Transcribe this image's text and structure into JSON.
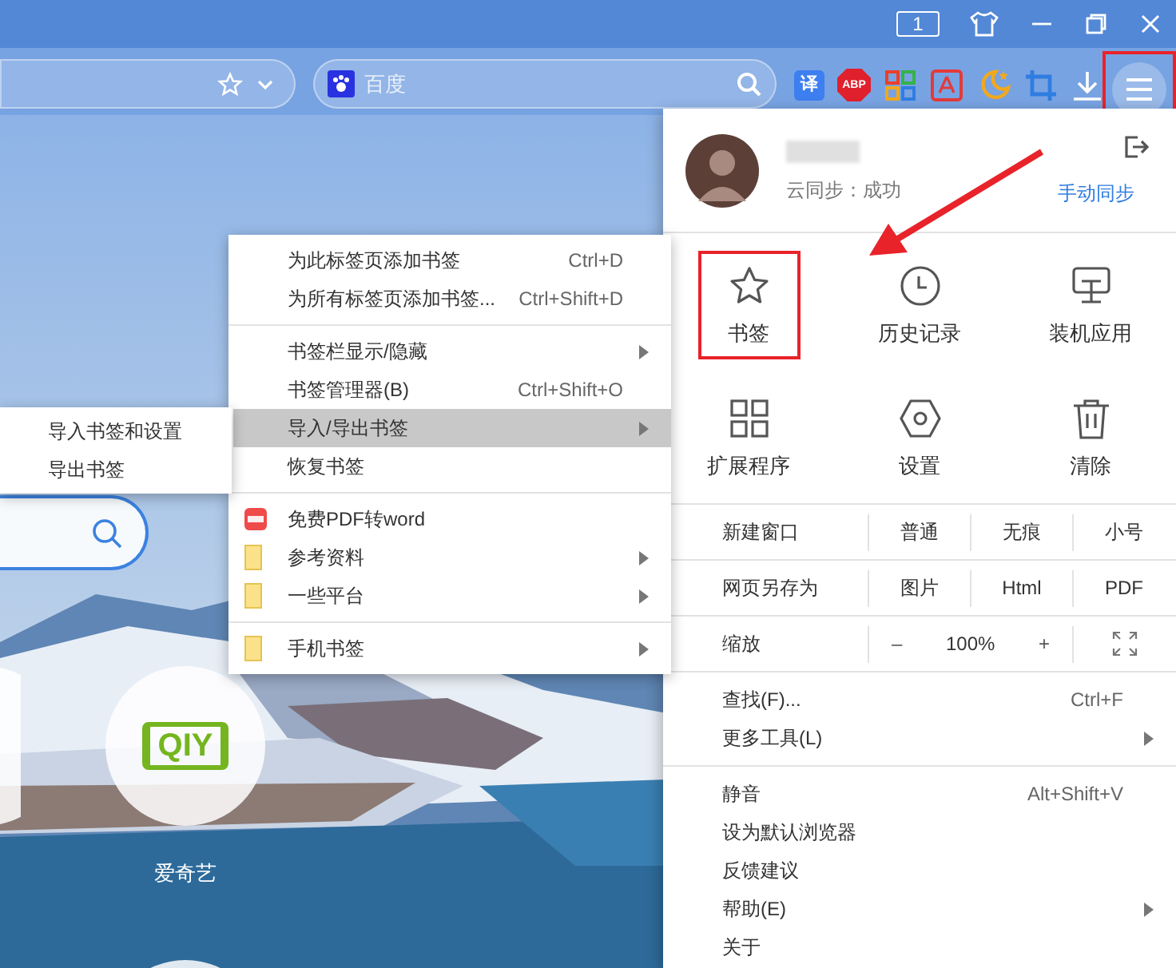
{
  "window_controls": {
    "tab_count": "1"
  },
  "toolbar": {
    "search_field": {
      "placeholder": "百度"
    },
    "extensions": [
      {
        "kind": "translate",
        "label": "译"
      },
      {
        "kind": "abp",
        "label": "ABP"
      },
      {
        "kind": "apps"
      },
      {
        "kind": "pdf"
      },
      {
        "kind": "night"
      },
      {
        "kind": "crop"
      },
      {
        "kind": "download"
      }
    ],
    "menu_button": {
      "highlighted": true
    }
  },
  "page": {
    "tiles": [
      {
        "kind": "blank"
      },
      {
        "kind": "iqiyi",
        "logo": "QIY",
        "label": "爱奇艺"
      },
      {
        "kind": "blank"
      }
    ]
  },
  "bookmark_menu": {
    "groups": [
      [
        {
          "kind": "plain",
          "label": "为此标签页添加书签",
          "shortcut": "Ctrl+D",
          "submenu": false,
          "selected": false
        },
        {
          "kind": "plain",
          "label": "为所有标签页添加书签...",
          "shortcut": "Ctrl+Shift+D",
          "submenu": false,
          "selected": false
        }
      ],
      [
        {
          "kind": "plain",
          "label": "书签栏显示/隐藏",
          "submenu": true,
          "selected": false
        },
        {
          "kind": "plain",
          "label": "书签管理器(B)",
          "shortcut": "Ctrl+Shift+O",
          "submenu": false,
          "selected": false
        },
        {
          "kind": "plain",
          "label": "导入/导出书签",
          "submenu": true,
          "selected": true
        },
        {
          "kind": "plain",
          "label": "恢复书签",
          "submenu": false,
          "selected": false
        }
      ],
      [
        {
          "kind": "pdf",
          "label": "免费PDF转word",
          "submenu": false,
          "selected": false
        },
        {
          "kind": "folder",
          "label": "参考资料",
          "submenu": true,
          "selected": false
        },
        {
          "kind": "folder",
          "label": "一些平台",
          "submenu": true,
          "selected": false
        }
      ],
      [
        {
          "kind": "folder",
          "label": "手机书签",
          "submenu": true,
          "selected": false
        }
      ]
    ]
  },
  "import_export_submenu": {
    "items": [
      "导入书签和设置",
      "导出书签"
    ]
  },
  "main_menu": {
    "profile": {
      "sync_status": "云同步：成功",
      "sync_button": "手动同步"
    },
    "grid": [
      {
        "kind": "star",
        "label": "书签",
        "highlighted": true
      },
      {
        "kind": "clock",
        "label": "历史记录",
        "highlighted": false
      },
      {
        "kind": "monitor",
        "label": "装机应用",
        "highlighted": false
      },
      {
        "kind": "squares",
        "label": "扩展程序",
        "highlighted": false
      },
      {
        "kind": "hexagon",
        "label": "设置",
        "highlighted": false
      },
      {
        "kind": "trash",
        "label": "清除",
        "highlighted": false
      }
    ],
    "option_rows": [
      {
        "kind": "options",
        "label": "新建窗口",
        "options": [
          "普通",
          "无痕",
          "小号"
        ]
      },
      {
        "kind": "options",
        "label": "网页另存为",
        "options": [
          "图片",
          "Html",
          "PDF"
        ]
      },
      {
        "kind": "zoom",
        "label": "缩放",
        "minus": "–",
        "value": "100%",
        "plus": "+"
      }
    ],
    "groups": [
      [
        {
          "label": "查找(F)...",
          "shortcut": "Ctrl+F",
          "submenu": false
        },
        {
          "label": "更多工具(L)",
          "submenu": true
        }
      ],
      [
        {
          "label": "静音",
          "shortcut": "Alt+Shift+V",
          "submenu": false
        },
        {
          "label": "设为默认浏览器",
          "submenu": false
        },
        {
          "label": "反馈建议",
          "submenu": false
        },
        {
          "label": "帮助(E)",
          "submenu": true
        },
        {
          "label": "关于",
          "submenu": false
        }
      ]
    ]
  }
}
